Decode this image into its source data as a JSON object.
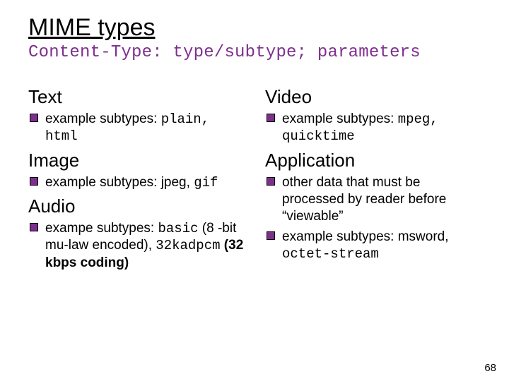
{
  "title": "MIME types",
  "subtitle": "Content-Type: type/subtype; parameters",
  "left": {
    "text": {
      "head": "Text",
      "bullet_prefix": "example subtypes: ",
      "subtypes": "plain, html"
    },
    "image": {
      "head": "Image",
      "bullet_prefix": "example subtypes: jpeg, ",
      "subtypes": "gif"
    },
    "audio": {
      "head": "Audio",
      "bullet_prefix": "exampe subtypes: ",
      "subtypes": "basic",
      "after1": " (8 -bit mu-law encoded), ",
      "subtypes2": "32kadpcm",
      "after2": " (32 kbps coding)"
    }
  },
  "right": {
    "video": {
      "head": "Video",
      "bullet_prefix": "example subtypes: ",
      "subtypes": "mpeg, quicktime"
    },
    "application": {
      "head": "Application",
      "bullet1": "other data that must be processed by reader before “viewable”",
      "bullet2_prefix": "example subtypes: msword, ",
      "bullet2_mono": "octet-stream"
    }
  },
  "page_number": "68"
}
